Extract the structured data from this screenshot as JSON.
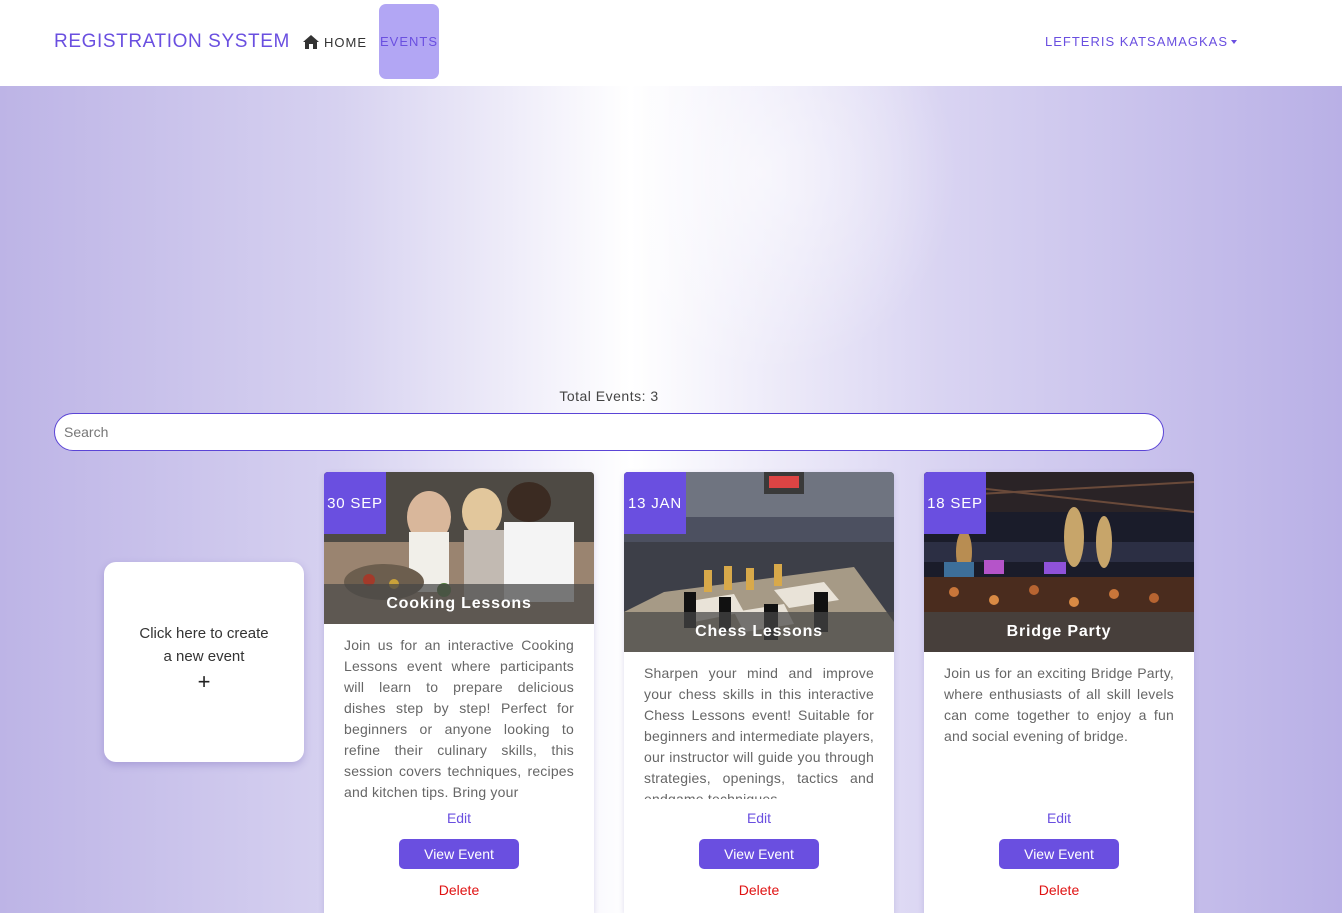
{
  "navbar": {
    "brand": "REGISTRATION SYSTEM",
    "home_label": "HOME",
    "home_icon": "home-icon",
    "events_label": "EVENTS",
    "user_label": "LEFTERIS KATSAMAGKAS",
    "user_caret_icon": "caret-down-icon"
  },
  "summary": {
    "total_events": "Total Events: 3"
  },
  "search": {
    "placeholder": "Search",
    "value": ""
  },
  "create_card": {
    "text": "Click here to create a new event",
    "plus": "+"
  },
  "events": [
    {
      "date": "30 SEP",
      "title": "Cooking Lessons",
      "description": "Join us for an interactive Cooking Lessons event where participants will learn to prepare delicious dishes step by step! Perfect for beginners or anyone looking to refine their culinary skills, this session covers techniques, recipes and kitchen tips. Bring your",
      "edit_label": "Edit",
      "view_label": "View Event",
      "delete_label": "Delete"
    },
    {
      "date": "13 JAN",
      "title": "Chess Lessons",
      "description": "Sharpen your mind and improve your chess skills in this interactive Chess Lessons event! Suitable for beginners and intermediate players, our instructor will guide you through strategies, openings, tactics and endgame techniques",
      "edit_label": "Edit",
      "view_label": "View Event",
      "delete_label": "Delete"
    },
    {
      "date": "18 SEP",
      "title": "Bridge Party",
      "description": "Join us for an exciting Bridge Party, where enthusiasts of all skill levels can come together to enjoy a fun and social evening of bridge.",
      "edit_label": "Edit",
      "view_label": "View Event",
      "delete_label": "Delete"
    }
  ],
  "colors": {
    "accent": "#6a4fe0",
    "active_nav": "#b2a6f4",
    "delete": "#e01212"
  }
}
